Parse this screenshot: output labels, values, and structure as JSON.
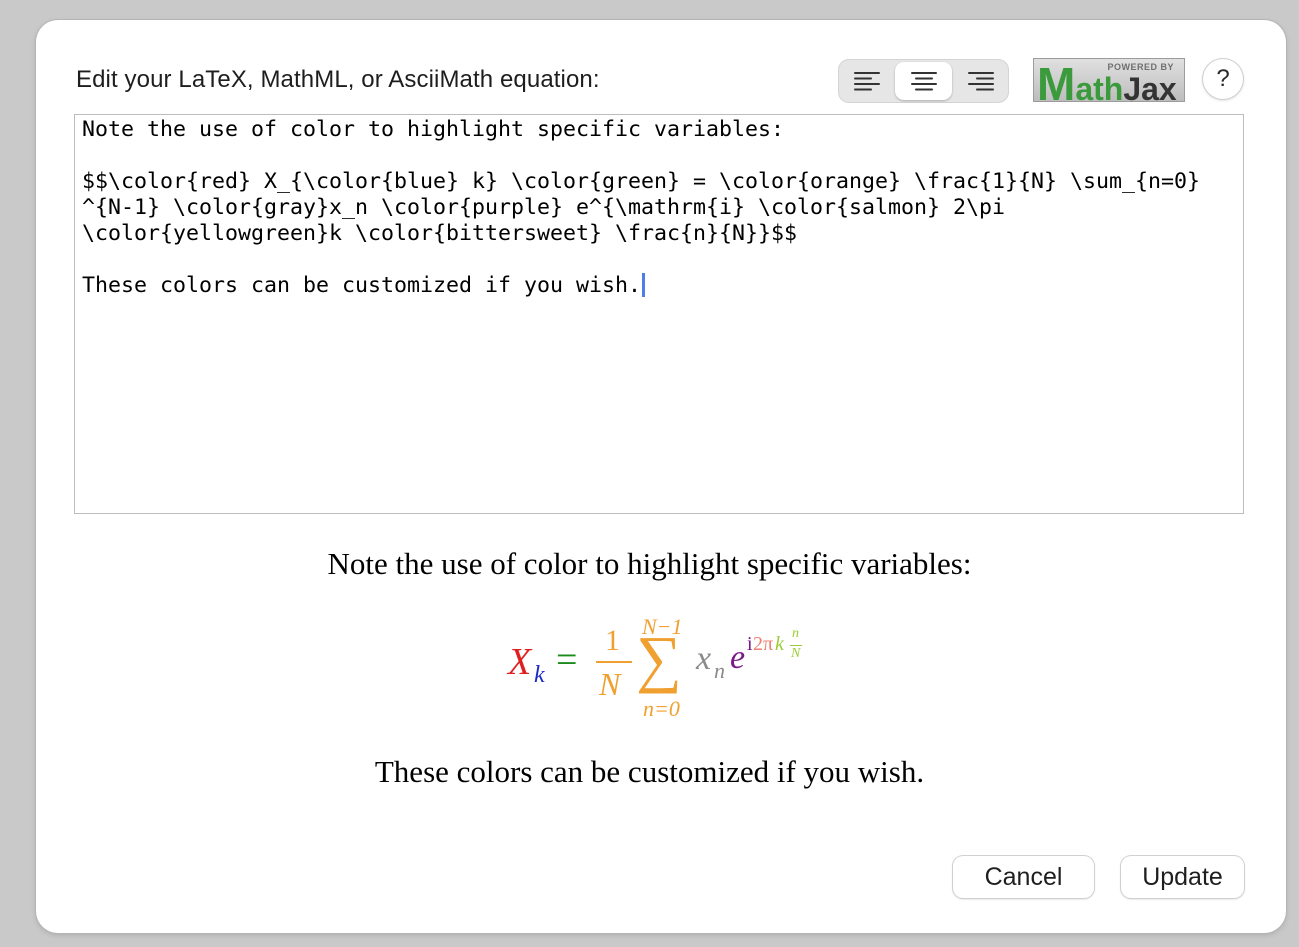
{
  "dialog": {
    "prompt": "Edit your LaTeX, MathML, or AsciiMath equation:",
    "align_buttons": [
      {
        "name": "align-left",
        "selected": false
      },
      {
        "name": "align-center",
        "selected": true
      },
      {
        "name": "align-right",
        "selected": false
      }
    ],
    "logo": {
      "powered_by": "POWERED BY",
      "m": "M",
      "ath": "ath",
      "jax": "Jax"
    },
    "help_label": "?",
    "editor_text": "Note the use of color to highlight specific variables:\n\n$$\\color{red} X_{\\color{blue} k} \\color{green} = \\color{orange} \\frac{1}{N} \\sum_{n=0}\n^{N-1} \\color{gray}x_n \\color{purple} e^{\\mathrm{i} \\color{salmon} 2\\pi\n\\color{yellowgreen}k \\color{bittersweet} \\frac{n}{N}}$$\n\nThese colors can be customized if you wish.",
    "preview": {
      "line1": "Note the use of color to highlight specific variables:",
      "line2": "These colors can be customized if you wish.",
      "formula": {
        "X": "X",
        "k": "k",
        "eq": "=",
        "frac_num": "1",
        "frac_den": "N",
        "sum_upper": "N−1",
        "sigma": "∑",
        "sum_lower": "n=0",
        "x": "x",
        "n_sub": "n",
        "e": "e",
        "i": "i",
        "two_pi": "2π",
        "k_exp": "k",
        "exp_frac_num": "n",
        "exp_frac_den": "N"
      }
    },
    "cancel_label": "Cancel",
    "update_label": "Update"
  },
  "colors": {
    "red": "#e02020",
    "blue": "#1c28c8",
    "orange": "#f0a030",
    "gray": "#8a8a8a",
    "purple": "#7a1a8a",
    "salmon": "#f08070",
    "yellowgreen": "#9acd32",
    "caret": "#4c7ef0"
  }
}
